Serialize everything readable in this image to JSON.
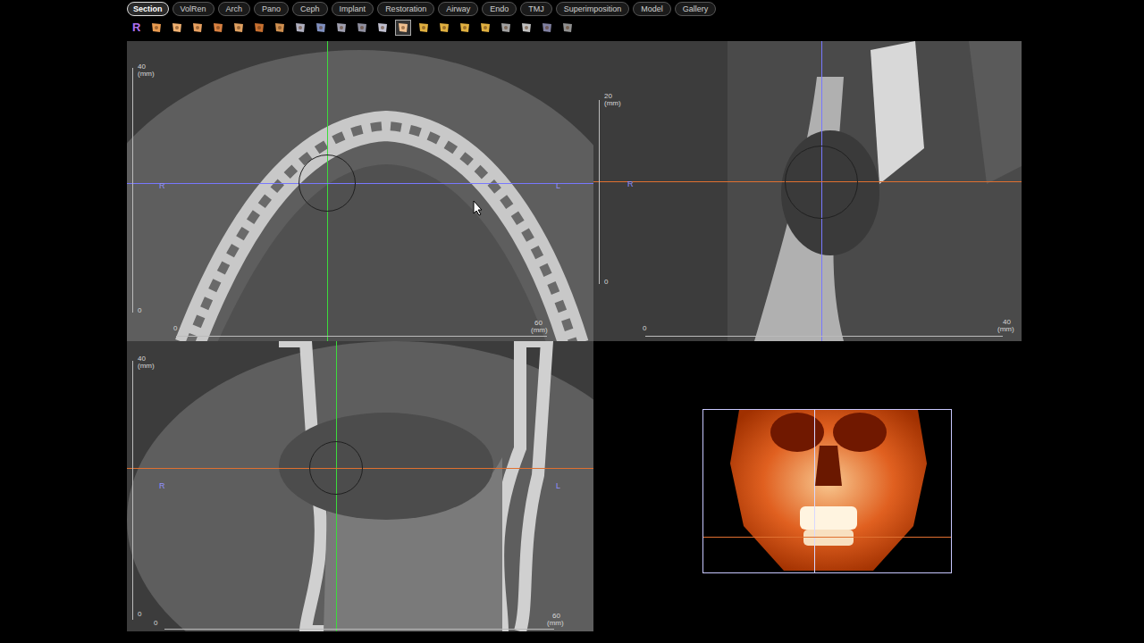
{
  "tabs": [
    {
      "label": "Section",
      "selected": true
    },
    {
      "label": "VolRen",
      "selected": false
    },
    {
      "label": "Arch",
      "selected": false
    },
    {
      "label": "Pano",
      "selected": false
    },
    {
      "label": "Ceph",
      "selected": false
    },
    {
      "label": "Implant",
      "selected": false
    },
    {
      "label": "Restoration",
      "selected": false
    },
    {
      "label": "Airway",
      "selected": false
    },
    {
      "label": "Endo",
      "selected": false
    },
    {
      "label": "TMJ",
      "selected": false
    },
    {
      "label": "Superimposition",
      "selected": false
    },
    {
      "label": "Model",
      "selected": false
    },
    {
      "label": "Gallery",
      "selected": false
    }
  ],
  "toolbar": {
    "label": "R"
  },
  "views": [
    {
      "name": "axial",
      "ruler_v": {
        "max": "40",
        "unit": "(mm)",
        "min": "0"
      },
      "ruler_h": {
        "min": "0",
        "max": "60",
        "unit": "(mm)"
      },
      "sides": [
        "R",
        "L"
      ]
    },
    {
      "name": "sagittal",
      "ruler_v": {
        "max": "20",
        "unit": "(mm)",
        "min": "0"
      },
      "ruler_h": {
        "min": "0",
        "max": "40",
        "unit": "(mm)"
      },
      "sides": [
        "R"
      ]
    },
    {
      "name": "coronal",
      "ruler_v": {
        "max": "40",
        "unit": "(mm)",
        "min": "0"
      },
      "ruler_h": {
        "min": "0",
        "max": "60",
        "unit": "(mm)"
      },
      "sides": [
        "R",
        "L"
      ]
    }
  ]
}
